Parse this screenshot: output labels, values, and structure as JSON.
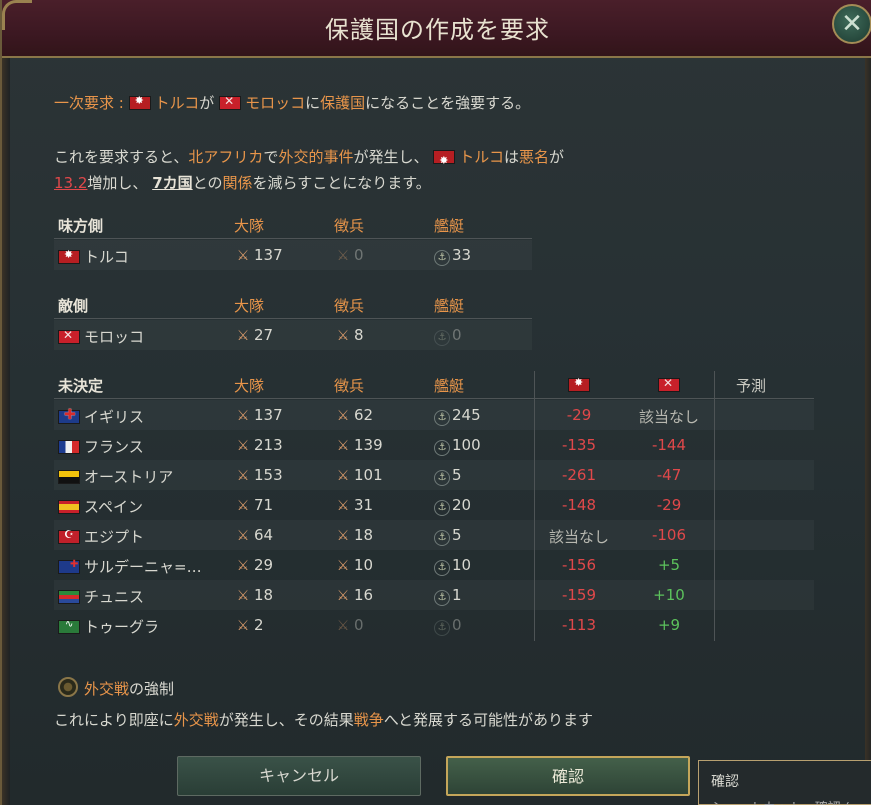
{
  "title": "保護国の作成を要求",
  "close_icon": "close-x-icon",
  "line1": {
    "prefix": "一次要求 : ",
    "country_a": "トルコ",
    "mid": "が",
    "country_b": "モロッコ",
    "mid2": "に",
    "keyword": "保護国",
    "suffix": "になることを強要する。"
  },
  "para2": {
    "t1": "これを要求すると、",
    "region": "北アフリカ",
    "t2": "で",
    "incident": "外交的事件",
    "t3": "が発生し、",
    "country": "トルコ",
    "t4": "は",
    "infamy": "悪名",
    "t5": "が",
    "infamy_value": "13.2",
    "t6": "増加し、 ",
    "count": "7カ国",
    "t7": "との",
    "relations": "関係",
    "t8": "を減らすことになります。"
  },
  "columns": {
    "army": "大隊",
    "conscripts": "徴兵",
    "ships": "艦艇",
    "forecast": "予測"
  },
  "ally": {
    "label": "味方側",
    "rows": [
      {
        "flag": "tur",
        "name": "トルコ",
        "army": "137",
        "conscripts": "0",
        "ships": "33"
      }
    ]
  },
  "enemy": {
    "label": "敵側",
    "rows": [
      {
        "flag": "mor",
        "name": "モロッコ",
        "army": "27",
        "conscripts": "8",
        "ships": "0"
      }
    ]
  },
  "undecided": {
    "label": "未決定",
    "rows": [
      {
        "flag": "gbr",
        "name": "イギリス",
        "army": "137",
        "conscripts": "62",
        "ships": "245",
        "tur": "-29",
        "mor": "該当なし"
      },
      {
        "flag": "fra",
        "name": "フランス",
        "army": "213",
        "conscripts": "139",
        "ships": "100",
        "tur": "-135",
        "mor": "-144"
      },
      {
        "flag": "aut",
        "name": "オーストリア",
        "army": "153",
        "conscripts": "101",
        "ships": "5",
        "tur": "-261",
        "mor": "-47"
      },
      {
        "flag": "esp",
        "name": "スペイン",
        "army": "71",
        "conscripts": "31",
        "ships": "20",
        "tur": "-148",
        "mor": "-29"
      },
      {
        "flag": "egy",
        "name": "エジプト",
        "army": "64",
        "conscripts": "18",
        "ships": "5",
        "tur": "該当なし",
        "mor": "-106"
      },
      {
        "flag": "sar",
        "name": "サルデーニャ=…",
        "army": "29",
        "conscripts": "10",
        "ships": "10",
        "tur": "-156",
        "mor": "+5"
      },
      {
        "flag": "tun",
        "name": "チュニス",
        "army": "18",
        "conscripts": "16",
        "ships": "1",
        "tur": "-159",
        "mor": "+10"
      },
      {
        "flag": "tug",
        "name": "トゥーグラ",
        "army": "2",
        "conscripts": "0",
        "ships": "0",
        "tur": "-113",
        "mor": "+9"
      }
    ]
  },
  "force": {
    "keyword": "外交戦",
    "label_rest": "の強制",
    "desc_t1": "これにより即座に",
    "desc_kw1": "外交戦",
    "desc_t2": "が発生し、その結果",
    "desc_kw2": "戦争",
    "desc_t3": "へと発展する可能性があります"
  },
  "buttons": {
    "cancel": "キャンセル",
    "confirm": "確認"
  },
  "tooltip": {
    "title": "確認",
    "shortcut": "ショートカット : 確認 ("
  },
  "colors": {
    "accent": "#e8954a",
    "negative": "#e0484a",
    "positive": "#5cc25c",
    "titlebar": "#3c1822"
  }
}
